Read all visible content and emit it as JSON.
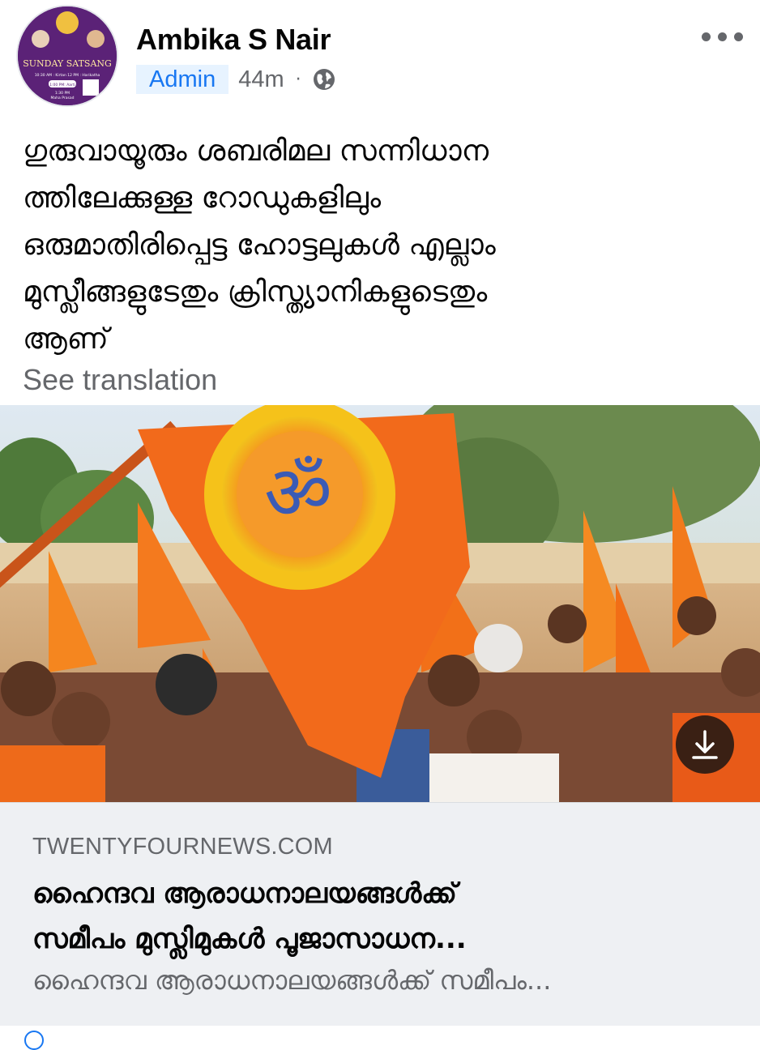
{
  "post": {
    "author": "Ambika S Nair",
    "role_badge": "Admin",
    "timestamp": "44m",
    "separator": "·",
    "privacy_icon": "globe-icon",
    "more_icon": "more-options-icon",
    "avatar": {
      "title": "SUNDAY SATSANG",
      "line1": "10:30 AM : Kirtan 12 PM : Harikatha",
      "line2": "1:00 PM: Aarti",
      "line3": "1:30 PM",
      "line4": "Maha Prasad"
    },
    "text_lines": [
      "ഗുരുവായൂരും ശബരിമല സന്നിധാന",
      "ത്തിലേക്കുള്ള റോഡുകളിലും",
      "ഒരുമാതിരിപ്പെട്ട ഹോട്ടലുകൾ എല്ലാം",
      "മുസ്ലീങ്ങളുടേതും ക്രിസ്ത്യാനികളുടെതും",
      "ആണ്"
    ],
    "see_translation": "See translation"
  },
  "link_preview": {
    "image_alt": "Saffron flags rally",
    "flag_symbol": "ॐ",
    "download_icon": "download-icon",
    "domain": "TWENTYFOURNEWS.COM",
    "headline_lines": [
      "ഹൈന്ദവ ആരാധനാലയങ്ങൾക്ക്",
      "സമീപം മുസ്ലിമുകൾ പൂജാസാധന..."
    ],
    "description": "ഹൈന്ദവ ആരാധനാലയങ്ങൾക്ക് സമീപം..."
  },
  "colors": {
    "accent": "#1877f2",
    "badge_bg": "#e7f3ff",
    "secondary_text": "#65676b",
    "card_bg": "#eef0f3",
    "saffron": "#f26a1b"
  }
}
